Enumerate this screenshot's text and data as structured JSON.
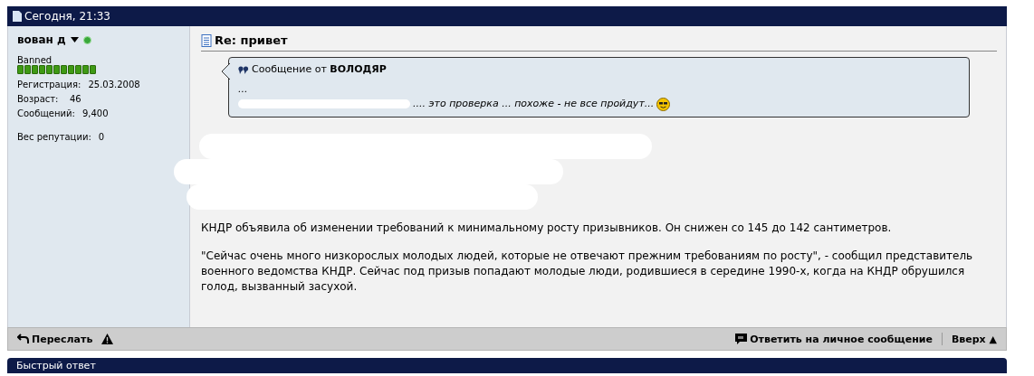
{
  "post_header": {
    "date": "Сегодня, 21:33"
  },
  "user": {
    "name": "вован д",
    "online": true,
    "title": "Banned",
    "stats": [
      {
        "label": "Регистрация:",
        "value": "25.03.2008"
      },
      {
        "label": "Возраст:",
        "value": "46"
      },
      {
        "label": "Сообщений:",
        "value": "9,400"
      }
    ],
    "reputation": {
      "label": "Вес репутации:",
      "value": "0"
    }
  },
  "post": {
    "title": "Re: привет",
    "quote": {
      "prefix": "Сообщение от",
      "author": "ВОЛОДЯР",
      "lines": [
        "...",
        ".... это проверка ... похоже - не все пройдут..."
      ]
    },
    "paragraphs": [
      "КНДР объявила об изменении требований к минимальному росту призывников. Он снижен со 145 до 142 сантиметров.",
      "\"Сейчас очень много низкорослых молодых людей, которые не отвечают прежним требованиям по росту\", - сообщил представитель военного ведомства КНДР. Сейчас под призыв попадают молодые люди, родившиеся в середине 1990-х, когда на КНДР обрушился голод, вызванный засухой."
    ]
  },
  "footer": {
    "forward": "Переслать",
    "reply_private": "Ответить на личное сообщение",
    "top": "Вверх ▲"
  },
  "quick_reply": {
    "title": "Быстрый ответ"
  }
}
